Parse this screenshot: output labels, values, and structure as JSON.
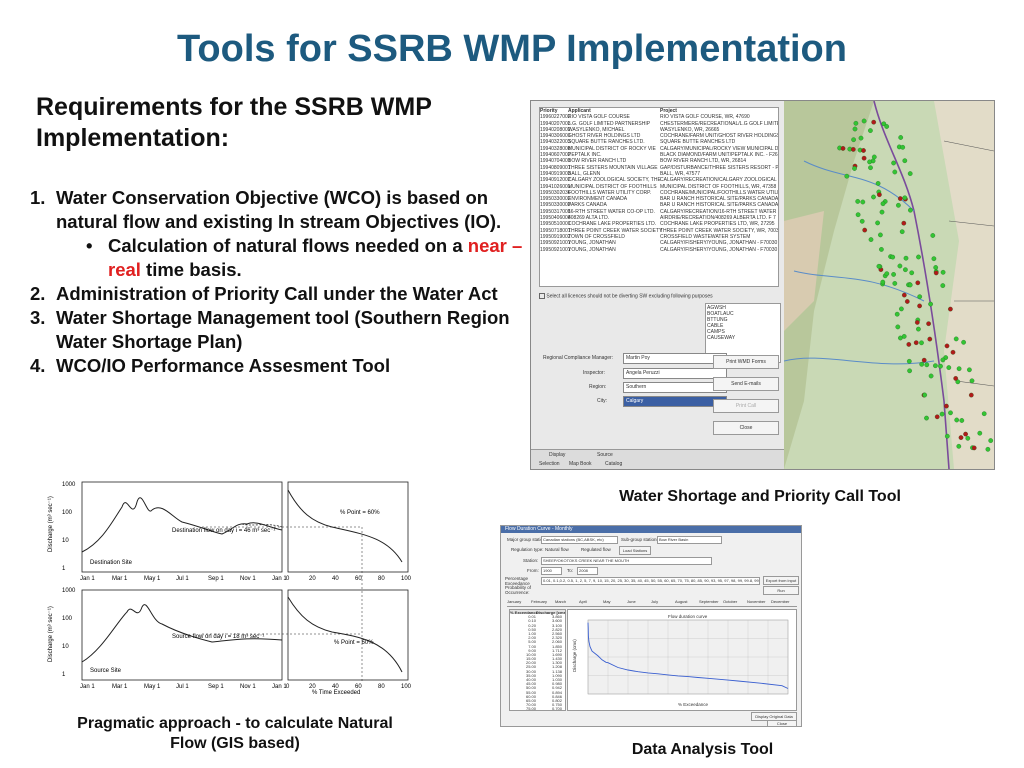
{
  "slide": {
    "title": "Tools for SSRB WMP Implementation",
    "subheading": "Requirements for the SSRB WMP Implementation:",
    "items": [
      {
        "num": "1.",
        "text": "Water Conservation Objective (WCO)  is based on natural flow and existing In stream Objectives (IO)."
      },
      {
        "num": "2.",
        "text": "Administration of Priority Call under the Water Act"
      },
      {
        "num": "3.",
        "text": "Water Shortage Management tool (Southern Region Water Shortage Plan)"
      },
      {
        "num": "4.",
        "text": "WCO/IO Performance Assesment Tool"
      }
    ],
    "sub_item": {
      "bullet": "•",
      "before": "Calculation of natural flows needed on a ",
      "highlight": "near – real",
      "after": " time basis."
    },
    "captions": {
      "priority_call": "Water Shortage and Priority Call Tool",
      "natural_flow": "Pragmatic approach - to calculate Natural Flow (GIS based)",
      "data_analysis": "Data Analysis Tool"
    },
    "colors": {
      "title": "#1d5a7f",
      "highlight": "#e02020"
    }
  },
  "priority_tool": {
    "headers": {
      "priority": "Priority",
      "applicant": "Applicant",
      "project": "Project"
    },
    "rows": [
      [
        "19960227002",
        "RIO VISTA GOLF COURSE",
        "RIO VISTA GOLF COURSE, WR, 47690"
      ],
      [
        "19940207003",
        "L.G. GOLF LIMITED PARTNERSHIP",
        "CHESTERMERE/RECREATIONAL/L.G GOLF LIMITED PA"
      ],
      [
        "19940208002",
        "WASYLENKO, MICHAEL",
        "WASYLENKO, WR, 26665"
      ],
      [
        "19940306001",
        "GHOST RIVER HOLDINGS LTD",
        "COCHRANE/FARM UNIT/GHOST RIVER HOLDINGS -"
      ],
      [
        "19940322003",
        "SQUARE BUTTE RANCHES LTD.",
        "SQUARE BUTTE RANCHES LTD"
      ],
      [
        "19940328008",
        "MUNICIPAL DISTRICT OF ROCKY VIE",
        "CALGARY/MUNICIPAL/ROCKY VIEW MUNICIPAL DIS"
      ],
      [
        "19940607002",
        "PEPTALK INC.",
        "BLACK DIAMOND/FARM UNIT/PEPTALK INC. - F26"
      ],
      [
        "19940704001",
        "BOW RIVER RANCH LTD",
        "BOW RIVER RANCH LTD, WR, 26814"
      ],
      [
        "19940809001",
        "THREE SISTERS MOUNTAIN VILLAGE",
        "GAP/DISTURBANCE/THREE SISTERS RESORT - P47"
      ],
      [
        "19940919003",
        "BALL, GLENN",
        "BALL, WR, 47577"
      ],
      [
        "19940912002",
        "CALGARY ZOOLOGICAL SOCIETY, THE",
        "CALGARY/RECREATION/CALGARY ZOOLOGICAL SO"
      ],
      [
        "19941026001",
        "MUNICIPAL DISTRICT OF FOOTHILLS",
        "MUNICIPAL DISTRICT OF FOOTHILLS, WR, 47358"
      ],
      [
        "19950302036",
        "FOOTHILLS WATER UTILITY CORP.",
        "COCHRANE/MUNICIPAL/FOOTHILLS WATER UTILIT"
      ],
      [
        "19950330002",
        "ENVIRONMENT CANADA",
        "BAR U RANCH HISTORICAL SITE/PARKS CANADA -"
      ],
      [
        "19950330003",
        "PARKS CANADA",
        "BAR U RANCH HISTORICAL SITE/PARKS CANADA -"
      ],
      [
        "19950317008",
        "16-RTH STREET WATER CO-OP LTD.",
        "CALGARY/RECREATION/16-RTH STREET WATER CO"
      ],
      [
        "19950406008",
        "408269 ALTA LTD.",
        "AIRDRIE/RECREATION/408269 ALBERTA LTD. F 7"
      ],
      [
        "19950510001",
        "COCHRANE LAKE PROPERTIES LTD.",
        "COCHRANE LAKE PROPERTIES LTD, WR, 27295"
      ],
      [
        "19950718001",
        "THREE POINT CREEK WATER SOCIETY",
        "THREE POINT CREEK WATER SOCIETY, WR, 70033"
      ],
      [
        "19950919002",
        "TOWN OF CROSSFIELD",
        "CROSSFIELD WASTEWATER SYSTEM"
      ],
      [
        "19950921001",
        "YOUNG, JONATHAN",
        "CALGARY/FISHERY/YOUNG, JONATHAN - F70030"
      ],
      [
        "19950921001",
        "YOUNG, JONATHAN",
        "CALGARY/FISHERY/YOUNG, JONATHAN - F70030"
      ]
    ],
    "checkbox_label": "Select all licences should not be diverting SW excluding following purposes",
    "purposes": [
      "AGWSH",
      "BOATLAUC",
      "BTTUNG",
      "CABLE",
      "CAMPS",
      "CAUSEWAY"
    ],
    "form": {
      "manager_label": "Regional Compliance Manager:",
      "manager_value": "Martin Poy",
      "inspector_label": "Inspector:",
      "inspector_value": "Angela Peruzzi",
      "region_label": "Region:",
      "region_value": "Southern",
      "city_label": "City:",
      "city_value": "Calgary"
    },
    "buttons": [
      "Print WMD Forms",
      "Send E-mails",
      "Print Call",
      "Close"
    ],
    "tabs_top": [
      "Display",
      "Source"
    ],
    "tabs_bottom": [
      "Selection",
      "Map Book",
      "Catalog"
    ]
  },
  "data_tool": {
    "window_title": "Flow Duration Curve - Monthly",
    "labels": {
      "major_group": "Major group stations:",
      "major_group_value": "Canadian stations (BC,ABSK, etc)",
      "sub_group": "Sub-group stations:",
      "sub_group_value": "Bow River Basin",
      "regulation": "Regulation type:",
      "natural": "Natural flow",
      "regulated": "Regulated flow",
      "load_stations": "Load Stations",
      "station": "Station:",
      "station_value": "SHEEP/OKOTOKS CREEK NEAR THE MOUTH",
      "from": "From:",
      "from_value": "1900",
      "to": "To:",
      "to_value": "2008",
      "pct_row": "Percentage Exceedance Probability of Occurrence:",
      "pct_values": "0.01, 0.1,0.2, 0.5, 1, 2, 5, 7, 9, 10, 15, 20, 25, 30, 35, 40, 45, 50, 55, 60, 65, 70, 75, 80, 85, 90, 93, 95, 97, 98, 99, 99.8, 99.9, 99.99",
      "export": "Export from input file",
      "run": "Run"
    },
    "months": [
      "January",
      "February",
      "March",
      "April",
      "May",
      "June",
      "July",
      "August",
      "September",
      "October",
      "November",
      "December"
    ],
    "table_headers": [
      "% Exceedance",
      "Discharge [cms]"
    ],
    "table_rows": [
      [
        "0.01",
        "3.860"
      ],
      [
        "0.10",
        "3.600"
      ],
      [
        "0.20",
        "3.100"
      ],
      [
        "0.50",
        "2.820"
      ],
      [
        "1.00",
        "2.560"
      ],
      [
        "2.00",
        "2.320"
      ],
      [
        "5.00",
        "2.060"
      ],
      [
        "7.00",
        "1.850"
      ],
      [
        "9.00",
        "1.712"
      ],
      [
        "10.00",
        "1.690"
      ],
      [
        "15.00",
        "1.430"
      ],
      [
        "20.00",
        "1.300"
      ],
      [
        "25.00",
        "1.208"
      ],
      [
        "30.00",
        "1.138"
      ],
      [
        "35.00",
        "1.090"
      ],
      [
        "40.00",
        "1.030"
      ],
      [
        "45.00",
        "0.980"
      ],
      [
        "50.00",
        "0.942"
      ],
      [
        "55.00",
        "0.894"
      ],
      [
        "60.00",
        "0.846"
      ],
      [
        "65.00",
        "0.802"
      ],
      [
        "70.00",
        "0.750"
      ],
      [
        "75.00",
        "0.700"
      ]
    ],
    "chart_title": "Flow duration curve",
    "x_label": "% Exceedance",
    "y_label": "Discharge (cms)",
    "display_original": "Display Original Data",
    "close": "Close"
  },
  "natural_flow": {
    "y_label": "Discharge (m³ sec⁻¹)",
    "x_label": "% Time Exceeded",
    "dest_note": "Destination flow on day i = 46 m³ sec⁻¹",
    "dest_site": "Destination Site",
    "src_note": "Source flow on day i = 18 m³ sec⁻¹",
    "src_site": "Source Site",
    "pct_top": "% Point = 60%",
    "pct_bottom": "% Point = 60%",
    "dates": [
      "Jan 1",
      "Mar 1",
      "May 1",
      "Jul 1",
      "Sep 1",
      "Nov 1",
      "Jan 1"
    ],
    "pct_ticks": [
      "0",
      "20",
      "40",
      "60",
      "80",
      "100"
    ],
    "y_ticks": [
      "1000",
      "100",
      "10",
      "1"
    ]
  }
}
